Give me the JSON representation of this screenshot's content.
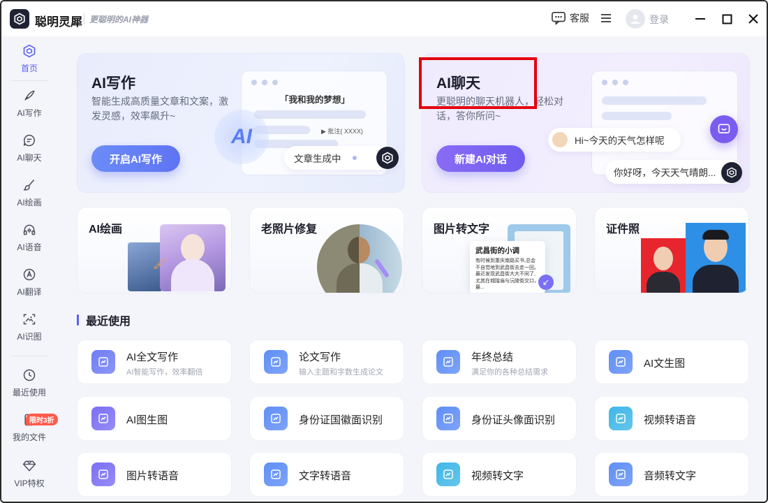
{
  "app": {
    "name": "聪明灵犀",
    "slogan": "更聪明的AI神器",
    "service_label": "客服",
    "login_label": "登录"
  },
  "sidebar": {
    "items": [
      {
        "label": "首页",
        "icon": "home-logo-icon",
        "active": true
      },
      {
        "label": "AI写作",
        "icon": "pen-icon"
      },
      {
        "label": "AI聊天",
        "icon": "chat-icon"
      },
      {
        "label": "AI绘画",
        "icon": "brush-icon"
      },
      {
        "label": "AI语音",
        "icon": "headphone-icon"
      },
      {
        "label": "AI翻译",
        "icon": "translate-icon"
      },
      {
        "label": "AI识图",
        "icon": "scan-image-icon"
      },
      {
        "label": "最近使用",
        "icon": "clock-icon"
      },
      {
        "label": "我的文件",
        "icon": "file-icon"
      },
      {
        "label": "VIP特权",
        "icon": "diamond-icon"
      }
    ],
    "vip_badge": "限时3折"
  },
  "hero": {
    "writing": {
      "title": "AI写作",
      "desc": "智能生成高质量文章和文案，激发灵感，效率飙升~",
      "button": "开启AI写作",
      "mock_title": "「我和我的梦想」",
      "mock_note": "批注( XXXX)",
      "mock_status": "文章生成中",
      "ai_mark": "AI"
    },
    "chat": {
      "title": "AI聊天",
      "desc": "更聪明的聊天机器人，轻松对话，答你所问~",
      "button": "新建AI对话",
      "bubble_user": "Hi~今天的天气怎样呢",
      "bubble_bot": "你好呀，今天天气晴朗..."
    }
  },
  "features": [
    {
      "title": "AI绘画"
    },
    {
      "title": "老照片修复"
    },
    {
      "title": "图片转文字",
      "doc_title": "武昌街的小调",
      "doc_text": "有时候到重庆南路买书,总会不自觉地到武昌街去走一回。最近发现武昌街大大不同了,尤其在城隍庙与沅陵街交口，最..."
    },
    {
      "title": "证件照"
    }
  ],
  "recent": {
    "title": "最近使用",
    "tools": [
      {
        "name": "AI全文写作",
        "sub": "AI智能写作，效率翻倍",
        "icon": "ai-write-icon",
        "color": "#6f7cf5"
      },
      {
        "name": "论文写作",
        "sub": "输入主题和字数生成论文",
        "icon": "thesis-icon",
        "color": "#5f8ef6"
      },
      {
        "name": "年终总结",
        "sub": "满足你的各种总结需求",
        "icon": "year-summary-icon",
        "color": "#5f8ef6"
      },
      {
        "name": "AI文生图",
        "sub": "",
        "icon": "text-to-image-icon",
        "color": "#5f8ef6"
      },
      {
        "name": "AI图生图",
        "sub": "",
        "icon": "image-to-image-icon",
        "color": "#7b6ff4"
      },
      {
        "name": "身份证国徽面识别",
        "sub": "",
        "icon": "id-emblem-icon",
        "color": "#5f8ef6"
      },
      {
        "name": "身份证头像面识别",
        "sub": "",
        "icon": "id-portrait-icon",
        "color": "#5f8ef6"
      },
      {
        "name": "视频转语音",
        "sub": "",
        "icon": "video-to-audio-icon",
        "color": "#3fb7e8"
      },
      {
        "name": "图片转语音",
        "sub": "",
        "icon": "image-to-audio-icon",
        "color": "#7b6ff4"
      },
      {
        "name": "文字转语音",
        "sub": "",
        "icon": "text-to-audio-icon",
        "color": "#5f8ef6"
      },
      {
        "name": "视频转文字",
        "sub": "",
        "icon": "video-to-text-icon",
        "color": "#3fb7e8"
      },
      {
        "name": "音频转文字",
        "sub": "",
        "icon": "audio-to-text-icon",
        "color": "#5f8ef6"
      }
    ]
  }
}
